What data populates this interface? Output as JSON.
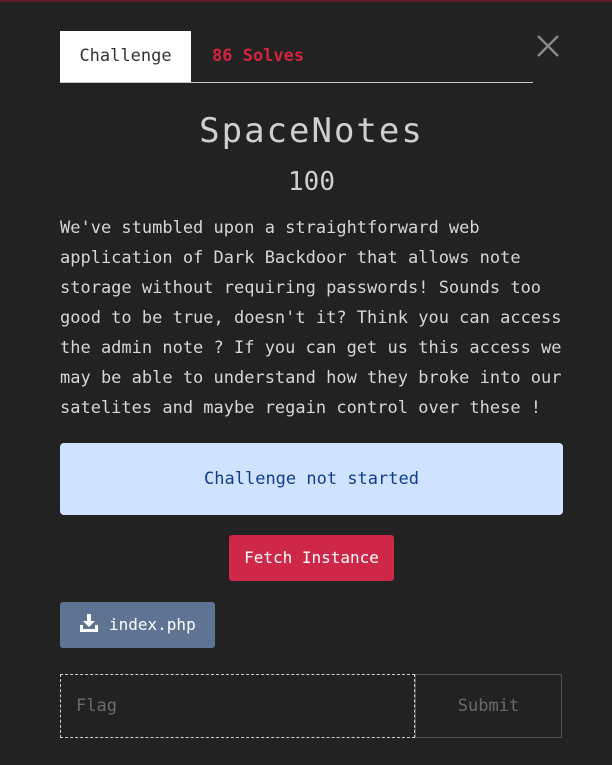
{
  "tabs": {
    "challenge": "Challenge",
    "solves": "86 Solves"
  },
  "challenge": {
    "title": "SpaceNotes",
    "points": "100",
    "description": "We've stumbled upon a straightforward web application of Dark Backdoor that allows note storage without requiring passwords! Sounds too good to be true, doesn't it? Think you can access the admin note ? If you can get us this access we may be able to understand how they broke into our satelites and maybe regain control over these !"
  },
  "instance": {
    "status": "Challenge not started",
    "fetch_label": "Fetch Instance"
  },
  "files": [
    {
      "name": "index.php",
      "icon": "download-icon"
    }
  ],
  "flag": {
    "placeholder": "Flag",
    "value": "",
    "submit_label": "Submit"
  },
  "colors": {
    "background": "#222222",
    "accent_red": "#cf2748",
    "solves_red": "#d4233f",
    "status_bg": "#cfe2ff",
    "status_text": "#0f3f8c",
    "file_button": "#5f7493"
  }
}
